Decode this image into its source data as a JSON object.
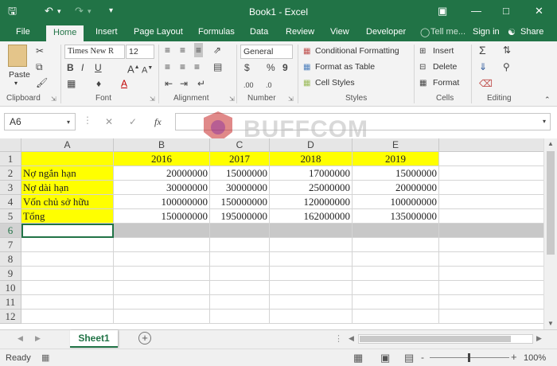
{
  "window": {
    "title": "Book1 - Excel"
  },
  "quick_access": {
    "save_icon": "save-icon",
    "undo_icon": "undo-icon",
    "redo_icon": "redo-icon",
    "customize_icon": "customize-icon"
  },
  "tabs": [
    {
      "label": "File"
    },
    {
      "label": "Home"
    },
    {
      "label": "Insert"
    },
    {
      "label": "Page Layout"
    },
    {
      "label": "Formulas"
    },
    {
      "label": "Data"
    },
    {
      "label": "Review"
    },
    {
      "label": "View"
    },
    {
      "label": "Developer"
    }
  ],
  "tell_me": "Tell me...",
  "sign_in": "Sign in",
  "share": "Share",
  "ribbon": {
    "clipboard": {
      "paste": "Paste",
      "label": "Clipboard"
    },
    "font": {
      "name": "Times New R",
      "size": "12",
      "label": "Font",
      "bold": "B",
      "italic": "I",
      "underline": "U"
    },
    "alignment": {
      "label": "Alignment"
    },
    "number": {
      "format": "General",
      "currency": "$",
      "percent": "%",
      "comma": "9",
      "label": "Number",
      "inc_dec": ".00",
      "dec_dec": ".0"
    },
    "styles": {
      "conditional": "Conditional Formatting",
      "format_table": "Format as Table",
      "cell_styles": "Cell Styles",
      "label": "Styles"
    },
    "cells": {
      "insert": "Insert",
      "delete": "Delete",
      "format": "Format",
      "label": "Cells"
    },
    "editing": {
      "label": "Editing"
    }
  },
  "formula_bar": {
    "name_box": "A6",
    "fx": "fx",
    "value": ""
  },
  "watermark": "BUFFCOM",
  "columns": [
    "A",
    "B",
    "C",
    "D",
    "E"
  ],
  "rows": [
    {
      "num": "1",
      "cells": [
        "",
        "2016",
        "2017",
        "2018",
        "2019"
      ]
    },
    {
      "num": "2",
      "cells": [
        "Nợ ngắn hạn",
        "20000000",
        "15000000",
        "17000000",
        "15000000"
      ]
    },
    {
      "num": "3",
      "cells": [
        "Nợ dài hạn",
        "30000000",
        "30000000",
        "25000000",
        "20000000"
      ]
    },
    {
      "num": "4",
      "cells": [
        "Vốn chủ sở hữu",
        "100000000",
        "150000000",
        "120000000",
        "100000000"
      ]
    },
    {
      "num": "5",
      "cells": [
        "Tổng",
        "150000000",
        "195000000",
        "162000000",
        "135000000"
      ]
    },
    {
      "num": "6",
      "cells": [
        "",
        "",
        "",
        "",
        ""
      ]
    },
    {
      "num": "7",
      "cells": [
        "",
        "",
        "",
        "",
        ""
      ]
    },
    {
      "num": "8",
      "cells": [
        "",
        "",
        "",
        "",
        ""
      ]
    },
    {
      "num": "9",
      "cells": [
        "",
        "",
        "",
        "",
        ""
      ]
    },
    {
      "num": "10",
      "cells": [
        "",
        "",
        "",
        "",
        ""
      ]
    },
    {
      "num": "11",
      "cells": [
        "",
        "",
        "",
        "",
        ""
      ]
    },
    {
      "num": "12",
      "cells": [
        "",
        "",
        "",
        "",
        ""
      ]
    }
  ],
  "sheets": [
    {
      "label": "Sheet1"
    }
  ],
  "status": {
    "ready": "Ready",
    "zoom": "100%",
    "zoom_minus": "-",
    "zoom_plus": "+"
  },
  "colors": {
    "accent": "#217346",
    "highlight": "#ffff00",
    "selection": "#c8c8c8"
  }
}
